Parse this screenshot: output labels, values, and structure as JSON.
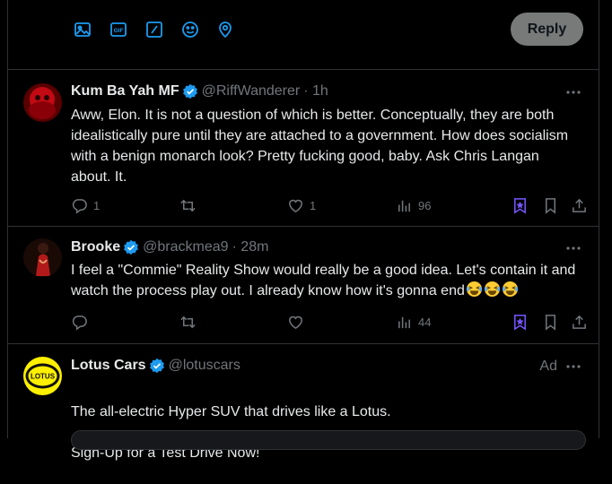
{
  "composer": {
    "tools": [
      "image-icon",
      "gif-icon",
      "list-icon",
      "emoji-icon",
      "location-icon"
    ],
    "gif_label": "GIF",
    "reply_label": "Reply"
  },
  "colors": {
    "accent": "#1d9bf0",
    "bookmark_active": "#7856ff",
    "muted": "#71767b",
    "border": "#2f3336"
  },
  "tweets": [
    {
      "name": "Kum Ba Yah MF",
      "handle": "@RiffWanderer",
      "time": "· 1h",
      "text": "Aww, Elon. It is not a question of which is better. Conceptually, they are both idealistically pure until they are attached to a government. How does socialism with a benign monarch look? Pretty fucking good, baby. Ask Chris Langan about. It.",
      "replies": "1",
      "retweets": "",
      "likes": "1",
      "views": "96"
    },
    {
      "name": "Brooke",
      "handle": "@brackmea9",
      "time": "· 28m",
      "text": "I feel a \"Commie\" Reality Show would really be a good idea. Let's contain it and watch the process play out. I already know how it's gonna end",
      "replies": "",
      "retweets": "",
      "likes": "",
      "views": "44"
    },
    {
      "name": "Lotus Cars",
      "handle": "@lotuscars",
      "ad_label": "Ad",
      "logo_text": "LOTUS",
      "line1": "The all-electric Hyper SUV that drives like a Lotus.",
      "line2": "Sign-Up for a Test Drive Now!"
    }
  ]
}
